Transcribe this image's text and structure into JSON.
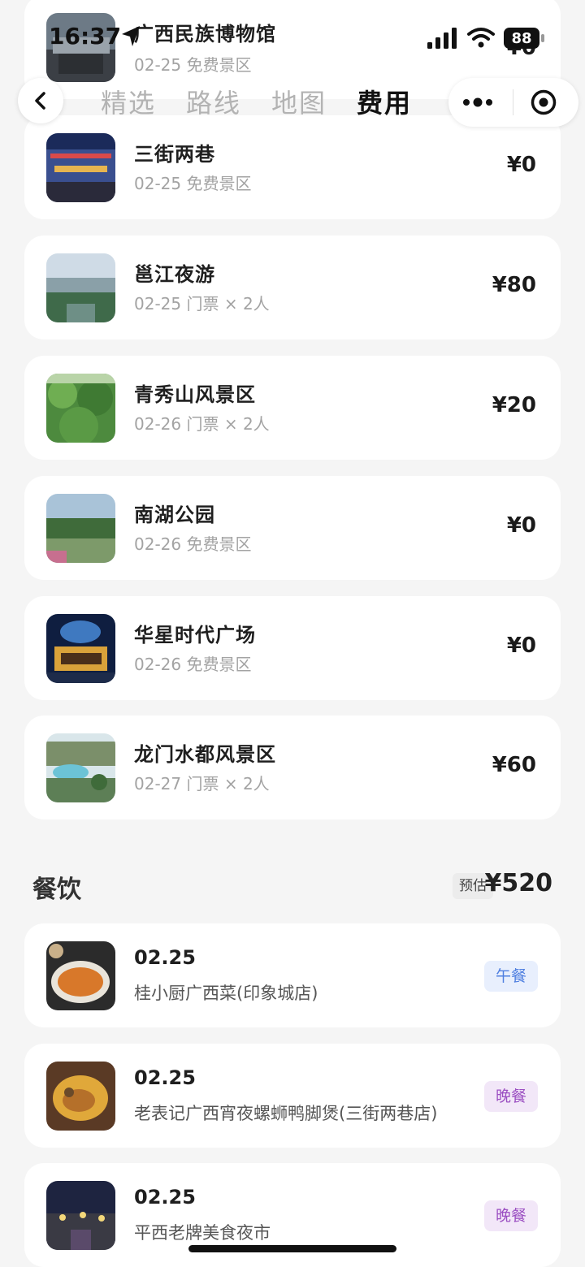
{
  "status_bar": {
    "time": "16:37",
    "battery": "88"
  },
  "nav": {
    "tabs": [
      "精选",
      "路线",
      "地图",
      "费用"
    ],
    "active_tab": "费用"
  },
  "attractions": [
    {
      "name": "广西民族博物馆",
      "detail": "02-25 免费景区",
      "price": "¥0"
    },
    {
      "name": "三街两巷",
      "detail": "02-25 免费景区",
      "price": "¥0"
    },
    {
      "name": "邕江夜游",
      "detail": "02-25 门票 × 2人",
      "price": "¥80"
    },
    {
      "name": "青秀山风景区",
      "detail": "02-26 门票 × 2人",
      "price": "¥20"
    },
    {
      "name": "南湖公园",
      "detail": "02-26 免费景区",
      "price": "¥0"
    },
    {
      "name": "华星时代广场",
      "detail": "02-26 免费景区",
      "price": "¥0"
    },
    {
      "name": "龙门水都风景区",
      "detail": "02-27 门票 × 2人",
      "price": "¥60"
    }
  ],
  "dining": {
    "title": "餐饮",
    "estimate_label": "预估",
    "estimate_value": "¥520",
    "items": [
      {
        "date": "02.25",
        "name": "桂小厨广西菜(印象城店)",
        "tag": "午餐"
      },
      {
        "date": "02.25",
        "name": "老表记广西宵夜螺蛳鸭脚煲(三街两巷店)",
        "tag": "晚餐"
      },
      {
        "date": "02.25",
        "name": "平西老牌美食夜市",
        "tag": "晚餐"
      }
    ]
  }
}
